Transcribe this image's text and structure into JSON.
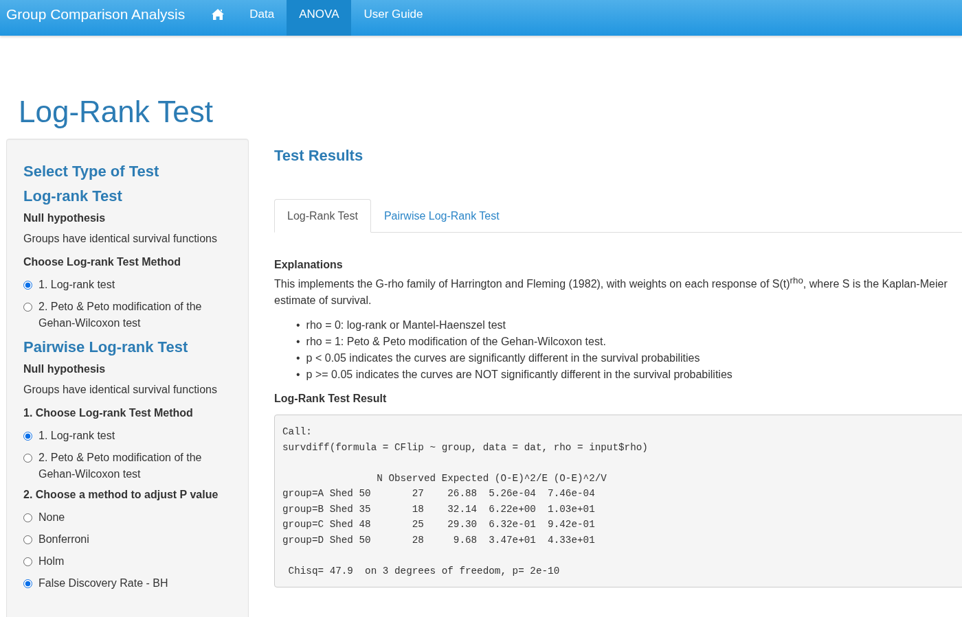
{
  "navbar": {
    "brand": "Group Comparison Analysis",
    "items": [
      {
        "kind": "home",
        "selected": false
      },
      {
        "kind": "text",
        "label": "Data",
        "selected": false
      },
      {
        "kind": "text",
        "label": "ANOVA",
        "selected": true
      },
      {
        "kind": "text",
        "label": "User Guide",
        "selected": false
      }
    ]
  },
  "title": "Log-Rank Test",
  "sidebar": {
    "items": [
      {
        "kind": "heading",
        "text": "Select Type of Test"
      },
      {
        "kind": "heading",
        "text": "Log-rank Test"
      },
      {
        "kind": "label",
        "text": "Null hypothesis"
      },
      {
        "kind": "text",
        "text": "Groups have identical survival functions"
      },
      {
        "kind": "label",
        "text": "Choose Log-rank Test Method"
      },
      {
        "kind": "radio",
        "text": "1. Log-rank test",
        "selected": true
      },
      {
        "kind": "radio",
        "text": "2. Peto & Peto modification of the Gehan-Wilcoxon test",
        "selected": false
      },
      {
        "kind": "heading",
        "text": "Pairwise Log-rank Test"
      },
      {
        "kind": "label",
        "text": "Null hypothesis"
      },
      {
        "kind": "text",
        "text": "Groups have identical survival functions"
      },
      {
        "kind": "label",
        "text": "1. Choose Log-rank Test Method"
      },
      {
        "kind": "radio",
        "text": "1. Log-rank test",
        "selected": true
      },
      {
        "kind": "radio",
        "text": "2. Peto & Peto modification of the Gehan-Wilcoxon test",
        "selected": false
      },
      {
        "kind": "label",
        "text": "2. Choose a method to adjust P value"
      },
      {
        "kind": "radio",
        "text": "None",
        "selected": false
      },
      {
        "kind": "radio",
        "text": "Bonferroni",
        "selected": false
      },
      {
        "kind": "radio",
        "text": "Holm",
        "selected": false
      },
      {
        "kind": "radio",
        "text": "False Discovery Rate - BH",
        "selected": true
      }
    ]
  },
  "main": {
    "heading": "Test Results",
    "tabs": [
      {
        "label": "Log-Rank Test",
        "selected": true
      },
      {
        "label": "Pairwise Log-Rank Test",
        "selected": false
      }
    ],
    "explanations_title": "Explanations",
    "explanation": "This implements the G-rho family of Harrington and Fleming (1982), with weights on each response of S(t)$^{rho}$, where S is the Kaplan-Meier estimate of survival.",
    "bullets": [
      {
        "marker": "•",
        "text": "rho = 0: log-rank or Mantel-Haenszel test"
      },
      {
        "marker": "•",
        "text": "rho = 1: Peto & Peto modification of the Gehan-Wilcoxon test."
      },
      {
        "marker": "•",
        "text": "p < 0.05 indicates the curves are significantly different in the survival probabilities"
      },
      {
        "marker": "•",
        "text": "p >= 0.05 indicates the curves are NOT significantly different in the survival probabilities"
      }
    ],
    "result_title": "Log-Rank Test Result",
    "output": [
      [
        "Call:",
        "survdiff(formula = CFlip ~ group, data = dat, rho = input$rho)"
      ],
      [
        "                N Observed Expected (O-E)^2/E (O-E)^2/V",
        "group=A Shed 50       27    26.88  5.26e-04  7.46e-04",
        "group=B Shed 35       18    32.14  6.22e+00  1.03e+01",
        "group=C Shed 48       25    29.30  6.32e-01  9.42e-01",
        "group=D Shed 50       28     9.68  3.47e+01  4.33e+01"
      ],
      [
        " Chisq= 47.9  on 3 degrees of freedom, p= 2e-10"
      ]
    ]
  }
}
